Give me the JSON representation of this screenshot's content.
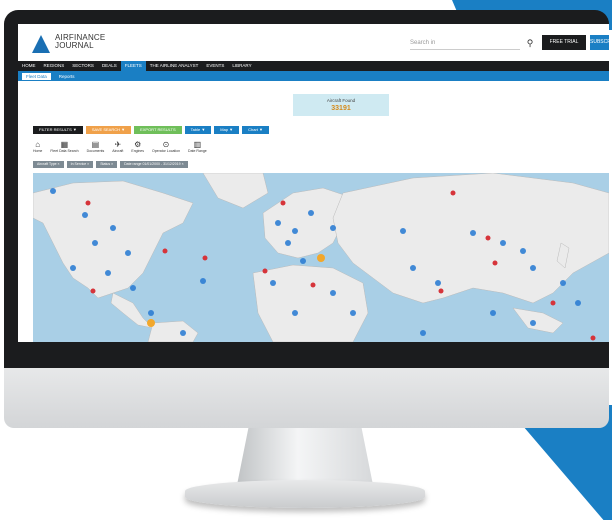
{
  "brand": {
    "line1": "AIRFINANCE",
    "line2": "JOURNAL"
  },
  "header": {
    "search_placeholder": "Search in",
    "free_trial": "FREE TRIAL",
    "subscribe": "SUBSCRIBE"
  },
  "nav": {
    "items": [
      "HOME",
      "REGIONS",
      "SECTORS",
      "DEALS",
      "FLEETS",
      "THE AIRLINE ANALYST",
      "EVENTS",
      "LIBRARY"
    ],
    "active": "FLEETS"
  },
  "subnav": {
    "items": [
      "Fleet Data",
      "Reports"
    ],
    "active": "Fleet Data"
  },
  "info_box": {
    "label": "Aircraft Found",
    "value": "33191"
  },
  "actions": [
    {
      "label": "FILTER RESULTS ▼",
      "color": "#1b1c1e"
    },
    {
      "label": "SAVE SEARCH ▼",
      "color": "#f0a14a"
    },
    {
      "label": "EXPORT RESULTS",
      "color": "#6fbf5a"
    },
    {
      "label": "Table ▼",
      "color": "#1a7fc4"
    },
    {
      "label": "Map ▼",
      "color": "#1a7fc4"
    },
    {
      "label": "Chart ▼",
      "color": "#1a7fc4"
    }
  ],
  "tools": [
    {
      "icon": "home-icon",
      "glyph": "⌂",
      "label": "Home"
    },
    {
      "icon": "fleet-icon",
      "glyph": "▦",
      "label": "Fleet Data Search"
    },
    {
      "icon": "document-icon",
      "glyph": "▤",
      "label": "Documents"
    },
    {
      "icon": "aircraft-icon",
      "glyph": "✈",
      "label": "Aircraft"
    },
    {
      "icon": "engine-icon",
      "glyph": "⚙",
      "label": "Engines"
    },
    {
      "icon": "location-icon",
      "glyph": "⊙",
      "label": "Operator Location"
    },
    {
      "icon": "calendar-icon",
      "glyph": "▥",
      "label": "Date Range"
    }
  ],
  "chips": [
    "Aircraft Type ×",
    "In Service ×",
    "Status ×",
    "Date range 01/01/2000 - 31/12/2019 ×"
  ],
  "colors": {
    "brand_blue": "#1a7fc4",
    "dark": "#1b1c1e",
    "map_water": "#a9cfe6",
    "land": "#ebebeb"
  }
}
